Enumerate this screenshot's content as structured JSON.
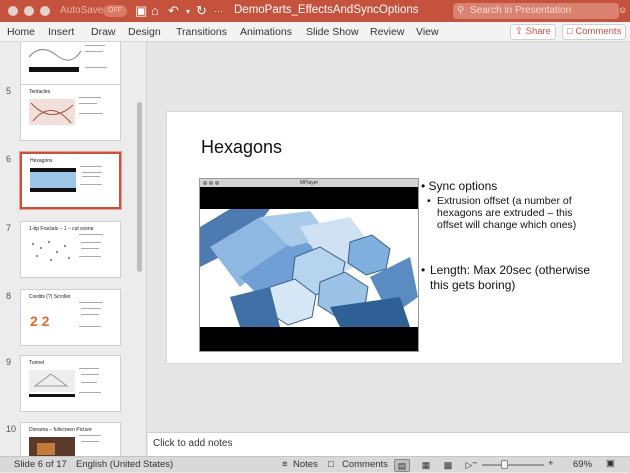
{
  "window": {
    "autosave_label": "AutoSave",
    "autosave_state": "OFF",
    "title": "DemoParts_EffectsAndSyncOptions",
    "search_placeholder": "Search in Presentation"
  },
  "ribbon": {
    "tabs": [
      "Home",
      "Insert",
      "Draw",
      "Design",
      "Transitions",
      "Animations",
      "Slide Show",
      "Review",
      "View"
    ],
    "share_label": "Share",
    "comments_label": "Comments"
  },
  "thumbnails": [
    {
      "number": "",
      "title": ""
    },
    {
      "number": "5",
      "title": "Tentacles"
    },
    {
      "number": "6",
      "title": "Hexagons"
    },
    {
      "number": "7",
      "title": "1-bp Fractals – 1 – cut scene"
    },
    {
      "number": "8",
      "title": "Credits (?) Scroller"
    },
    {
      "number": "9",
      "title": "Tunnel"
    },
    {
      "number": "10",
      "title": "Diorama – fullscreen Picture"
    }
  ],
  "slide": {
    "title": "Hexagons",
    "player_title": "MPlayer",
    "bullets": [
      {
        "text": "Sync options",
        "sub": [
          "Extrusion offset (a number of hexagons are extruded – this offset will change which ones)"
        ]
      },
      {
        "text": "Length: Max 20sec (otherwise this gets boring)",
        "sub": []
      }
    ]
  },
  "notes": {
    "placeholder": "Click to add notes"
  },
  "status": {
    "slide_position": "Slide 6 of 17",
    "language": "English (United States)",
    "notes_label": "Notes",
    "comments_label": "Comments",
    "zoom": "69%"
  }
}
